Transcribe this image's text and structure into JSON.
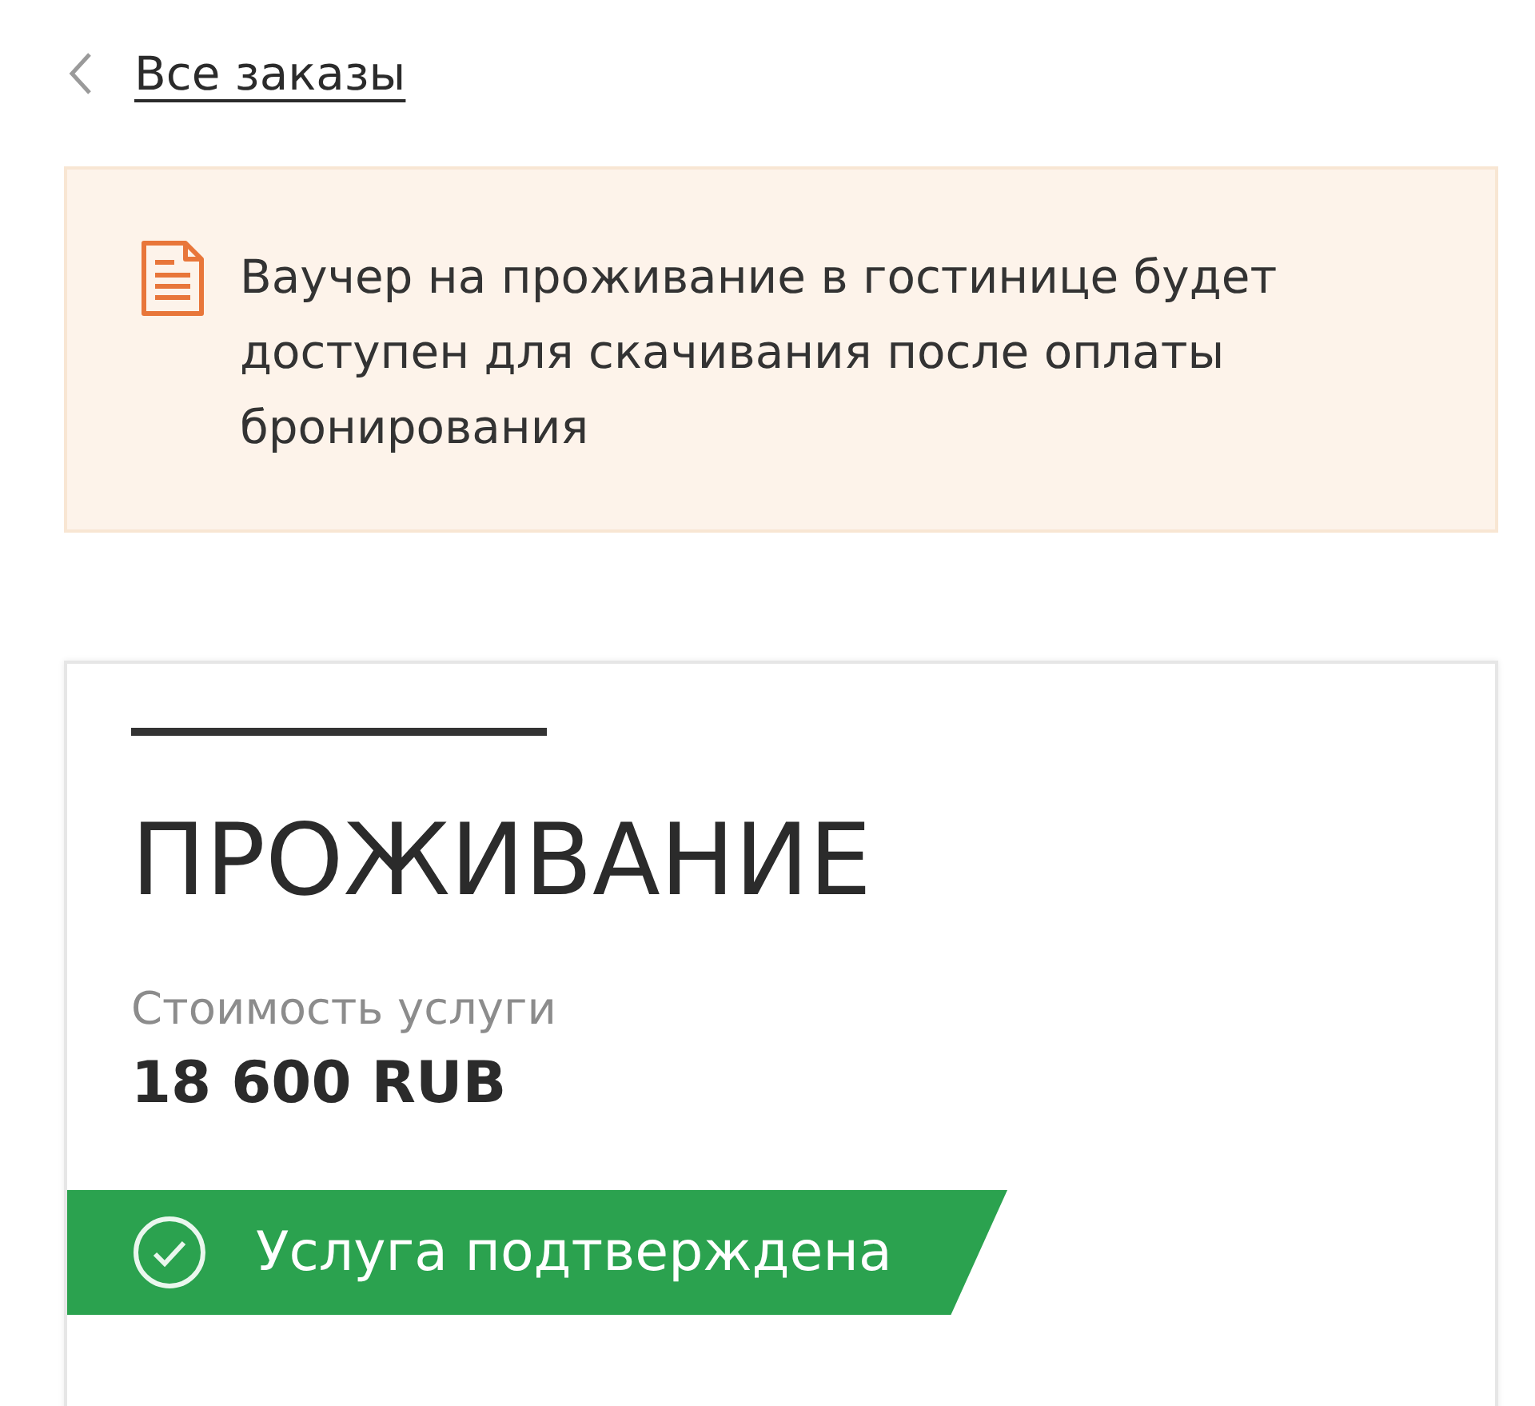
{
  "back_link": {
    "label": "Все заказы"
  },
  "notice": {
    "text": "Ваучер на проживание в гостинице будет доступен для скачивания после оплаты бронирования"
  },
  "service_card": {
    "title": "ПРОЖИВАНИЕ",
    "price_label": "Стоимость услуги",
    "price": "18 600 RUB",
    "status": {
      "kind": "confirmed",
      "label": "Услуга подтверждена"
    }
  }
}
